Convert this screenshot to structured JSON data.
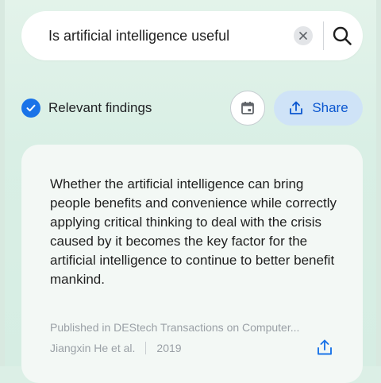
{
  "search": {
    "query": "Is artificial intelligence useful",
    "clear_icon": "close-icon",
    "search_icon": "search-icon"
  },
  "controls": {
    "relevant_label": "Relevant findings",
    "relevant_checked": true,
    "calendar_icon": "calendar-icon",
    "share_label": "Share",
    "share_icon": "share-icon"
  },
  "result": {
    "finding": "Whether the artificial intelligence can bring people benefits and convenience while correctly applying critical thinking to deal with the crisis caused by it becomes the key factor for the artificial intelligence to continue to better benefit mankind.",
    "published": "Published in DEStech Transactions on Computer...",
    "authors": "Jiangxin He et al.",
    "year": "2019"
  },
  "colors": {
    "accent": "#1a73e8",
    "share_bg": "#cfe3f7",
    "share_text": "#0b57d0",
    "background": "#dcefe6"
  }
}
